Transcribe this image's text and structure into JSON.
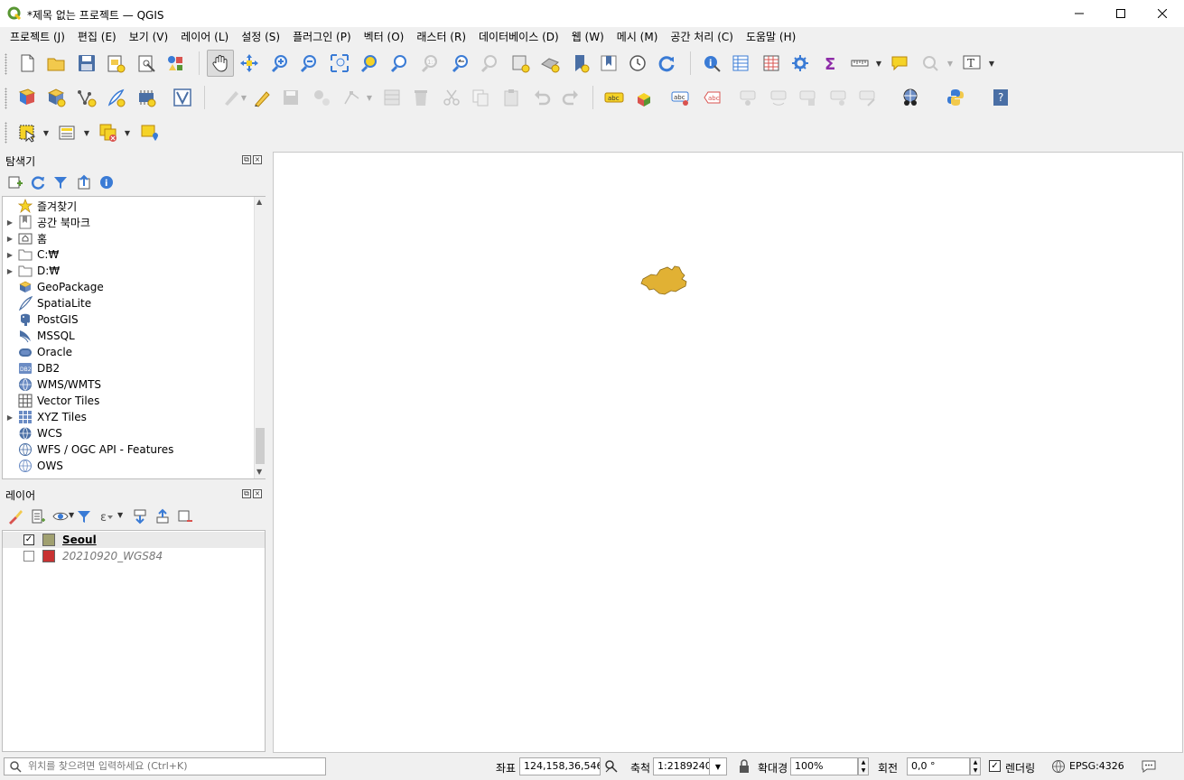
{
  "window": {
    "title": "*제목 없는 프로젝트 — QGIS"
  },
  "menu": [
    "프로젝트 (J)",
    "편집 (E)",
    "보기 (V)",
    "레이어 (L)",
    "설정 (S)",
    "플러그인 (P)",
    "벡터 (O)",
    "래스터 (R)",
    "데이터베이스 (D)",
    "웹 (W)",
    "메시 (M)",
    "공간 처리 (C)",
    "도움말 (H)"
  ],
  "browser_panel": {
    "title": "탐색기",
    "items": [
      {
        "label": "즐겨찾기",
        "icon": "star-icon",
        "expandable": false
      },
      {
        "label": "공간 북마크",
        "icon": "bookmark-icon",
        "expandable": true
      },
      {
        "label": "홈",
        "icon": "home-folder-icon",
        "expandable": true
      },
      {
        "label": "C:₩",
        "icon": "drive-icon",
        "expandable": true
      },
      {
        "label": "D:₩",
        "icon": "drive-icon",
        "expandable": true
      },
      {
        "label": "GeoPackage",
        "icon": "geopackage-icon",
        "expandable": false
      },
      {
        "label": "SpatiaLite",
        "icon": "spatialite-icon",
        "expandable": false
      },
      {
        "label": "PostGIS",
        "icon": "postgis-icon",
        "expandable": false
      },
      {
        "label": "MSSQL",
        "icon": "mssql-icon",
        "expandable": false
      },
      {
        "label": "Oracle",
        "icon": "oracle-icon",
        "expandable": false
      },
      {
        "label": "DB2",
        "icon": "db2-icon",
        "expandable": false
      },
      {
        "label": "WMS/WMTS",
        "icon": "wms-globe-icon",
        "expandable": false
      },
      {
        "label": "Vector Tiles",
        "icon": "vector-tiles-icon",
        "expandable": false
      },
      {
        "label": "XYZ Tiles",
        "icon": "xyz-tiles-icon",
        "expandable": true
      },
      {
        "label": "WCS",
        "icon": "wcs-globe-icon",
        "expandable": false
      },
      {
        "label": "WFS / OGC API - Features",
        "icon": "wfs-globe-icon",
        "expandable": false
      },
      {
        "label": "OWS",
        "icon": "ows-globe-icon",
        "expandable": false
      }
    ]
  },
  "layers_panel": {
    "title": "레이어",
    "layers": [
      {
        "name": "Seoul",
        "checked": true,
        "color": "#a0a070",
        "bold": true
      },
      {
        "name": "20210920_WGS84",
        "checked": false,
        "color": "#c83232",
        "bold": false
      }
    ]
  },
  "map": {
    "feature_color": "#e1b134"
  },
  "statusbar": {
    "locator_placeholder": "위치를 찾으려면 입력하세요 (Ctrl+K)",
    "coordinate_label": "좌표",
    "coordinate_value": "124,158,36,546",
    "scale_label": "축척",
    "scale_value": "1:2189240",
    "magnifier_label": "확대경",
    "magnifier_value": "100%",
    "rotation_label": "회전",
    "rotation_value": "0,0 °",
    "render_label": "렌더링",
    "render_checked": true,
    "crs_label": "EPSG:4326"
  },
  "colors": {
    "accent_blue": "#3a7bd5",
    "qgis_green": "#589632",
    "selection_yellow": "#f5d327"
  }
}
